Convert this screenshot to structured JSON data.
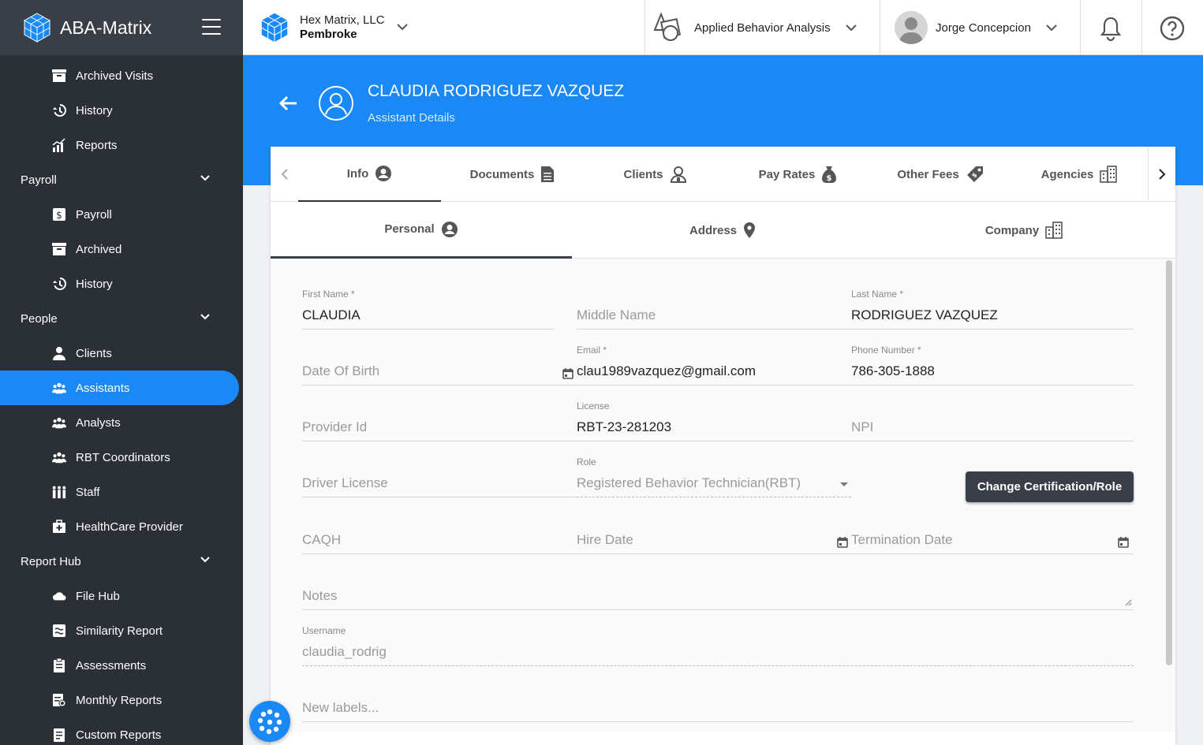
{
  "app": {
    "name": "ABA-Matrix"
  },
  "sidebar": {
    "items": [
      {
        "label": "Archived Visits",
        "icon": "archive-icon"
      },
      {
        "label": "History",
        "icon": "history-icon"
      },
      {
        "label": "Reports",
        "icon": "reports-icon"
      }
    ],
    "payroll": {
      "label": "Payroll",
      "items": [
        {
          "label": "Payroll",
          "icon": "payroll-icon"
        },
        {
          "label": "Archived",
          "icon": "archive-icon"
        },
        {
          "label": "History",
          "icon": "history-icon"
        }
      ]
    },
    "people": {
      "label": "People",
      "items": [
        {
          "label": "Clients",
          "icon": "person-icon"
        },
        {
          "label": "Assistants",
          "icon": "group-icon"
        },
        {
          "label": "Analysts",
          "icon": "group-icon"
        },
        {
          "label": "RBT Coordinators",
          "icon": "group-icon"
        },
        {
          "label": "Staff",
          "icon": "staff-icon"
        },
        {
          "label": "HealthCare Provider",
          "icon": "medical-icon"
        }
      ]
    },
    "report_hub": {
      "label": "Report Hub",
      "items": [
        {
          "label": "File Hub",
          "icon": "cloud-icon"
        },
        {
          "label": "Similarity Report",
          "icon": "similarity-icon"
        },
        {
          "label": "Assessments",
          "icon": "assessment-icon"
        },
        {
          "label": "Monthly Reports",
          "icon": "monthly-report-icon"
        },
        {
          "label": "Custom Reports",
          "icon": "custom-report-icon"
        }
      ]
    }
  },
  "topbar": {
    "company_name": "Hex Matrix, LLC",
    "company_location": "Pembroke",
    "specialty": "Applied Behavior Analysis",
    "user_name": "Jorge Concepcion"
  },
  "header": {
    "title": "CLAUDIA RODRIGUEZ VAZQUEZ",
    "subtitle": "Assistant Details"
  },
  "tabs": [
    {
      "label": "Info",
      "icon": "account-circle-icon"
    },
    {
      "label": "Documents",
      "icon": "document-icon"
    },
    {
      "label": "Clients",
      "icon": "person-outline-icon"
    },
    {
      "label": "Pay Rates",
      "icon": "money-bag-icon"
    },
    {
      "label": "Other Fees",
      "icon": "tag-icon"
    },
    {
      "label": "Agencies",
      "icon": "building-icon"
    }
  ],
  "subtabs": [
    {
      "label": "Personal",
      "icon": "account-circle-icon"
    },
    {
      "label": "Address",
      "icon": "location-pin-icon"
    },
    {
      "label": "Company",
      "icon": "building-icon"
    }
  ],
  "form": {
    "first_name": {
      "label": "First Name *",
      "value": "CLAUDIA"
    },
    "middle_name": {
      "placeholder": "Middle Name"
    },
    "last_name": {
      "label": "Last Name *",
      "value": "RODRIGUEZ VAZQUEZ"
    },
    "dob": {
      "placeholder": "Date Of Birth"
    },
    "email": {
      "label": "Email *",
      "value": "clau1989vazquez@gmail.com"
    },
    "phone": {
      "label": "Phone Number *",
      "value": "786-305-1888"
    },
    "provider_id": {
      "placeholder": "Provider Id"
    },
    "license": {
      "label": "License",
      "value": "RBT-23-281203"
    },
    "npi": {
      "placeholder": "NPI"
    },
    "driver_license": {
      "placeholder": "Driver License"
    },
    "role": {
      "label": "Role",
      "value": "Registered Behavior Technician(RBT)"
    },
    "change_role_button": "Change Certification/Role",
    "caqh": {
      "placeholder": "CAQH"
    },
    "hire_date": {
      "placeholder": "Hire Date"
    },
    "termination_date": {
      "placeholder": "Termination Date"
    },
    "notes": {
      "placeholder": "Notes"
    },
    "username": {
      "label": "Username",
      "value": "claudia_rodrig"
    },
    "labels": {
      "placeholder": "New labels..."
    }
  },
  "colors": {
    "accent": "#1a88f5",
    "sidebar": "#2b2f36",
    "dark_button": "#3a3f47"
  }
}
